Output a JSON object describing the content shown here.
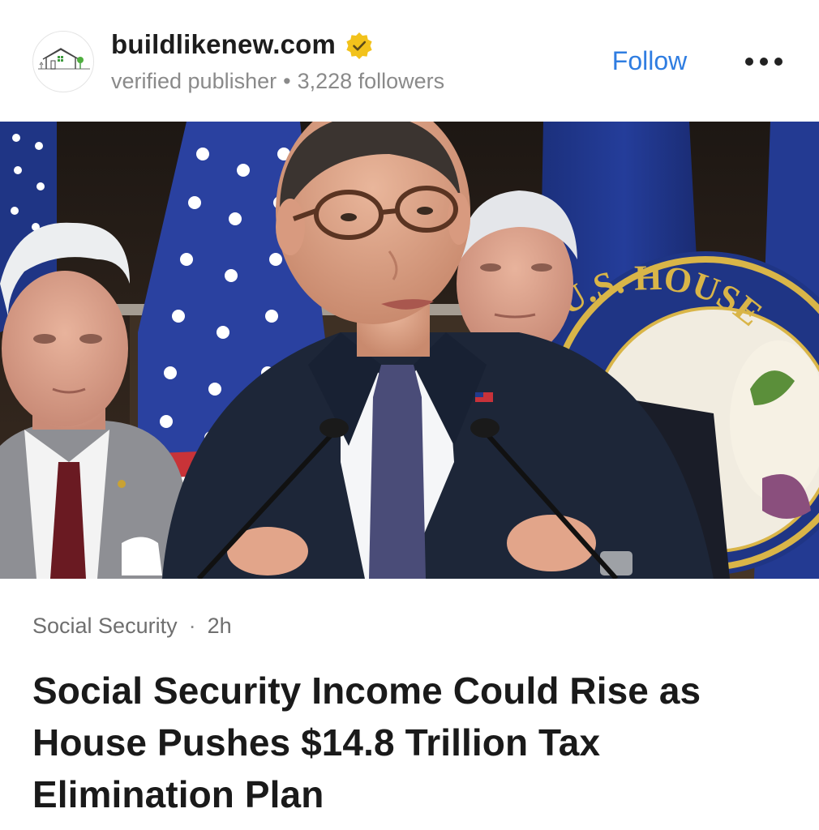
{
  "publisher": {
    "name": "buildlikenew.com",
    "verified_label": "verified publisher",
    "separator": "•",
    "followers": "3,228 followers",
    "follow_label": "Follow"
  },
  "hero": {
    "alt": "Man in glasses and suit speaking at microphones in front of American flags and a U.S. House seal, with two older men standing behind him"
  },
  "hero_seal_text": "U.S. HOUSE",
  "article": {
    "category": "Social Security",
    "separator": "·",
    "time": "2h",
    "headline": "Social Security Income Could Rise as House Pushes $14.8 Trillion Tax Elimination Plan"
  },
  "colors": {
    "accent": "#2f7de1",
    "verified_badge": "#f2c21b",
    "text_primary": "#1a1a1a",
    "text_secondary": "#8a8a8a"
  },
  "icons": {
    "avatar": "house-logo-icon",
    "verified": "verified-badge-icon",
    "more": "more-options-icon"
  }
}
